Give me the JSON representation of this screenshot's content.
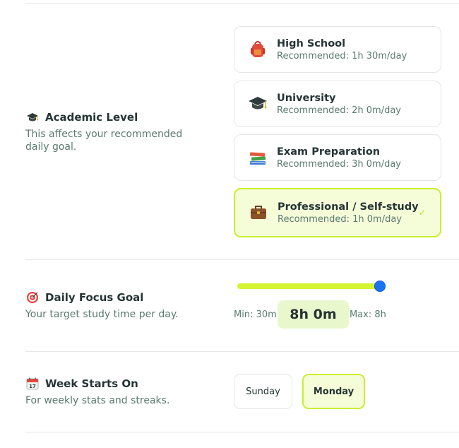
{
  "academic": {
    "title": "Academic Level",
    "icon": "graduation-cap-icon",
    "description": "This affects your recommended daily goal.",
    "options": [
      {
        "name": "High School",
        "recommended": "Recommended: 1h 30m/day",
        "icon": "backpack-icon",
        "selected": false
      },
      {
        "name": "University",
        "recommended": "Recommended: 2h 0m/day",
        "icon": "graduation-cap-icon",
        "selected": false
      },
      {
        "name": "Exam Preparation",
        "recommended": "Recommended: 3h 0m/day",
        "icon": "books-icon",
        "selected": false
      },
      {
        "name": "Professional / Self-study",
        "recommended": "Recommended: 1h 0m/day",
        "icon": "briefcase-icon",
        "selected": true,
        "check": "✓"
      }
    ]
  },
  "focus": {
    "title": "Daily Focus Goal",
    "icon": "target-icon",
    "description": "Your target study time per day.",
    "min_label": "Min: 30m",
    "max_label": "Max: 8h",
    "value_label": "8h 0m",
    "slider_fraction": 1.0,
    "accent_color": "#d5f531",
    "thumb_color": "#1a73f0"
  },
  "week": {
    "title": "Week Starts On",
    "icon": "calendar-icon",
    "calendar_date": "17",
    "description": "For weekly stats and streaks.",
    "options": [
      {
        "label": "Sunday",
        "selected": false
      },
      {
        "label": "Monday",
        "selected": true
      }
    ]
  }
}
